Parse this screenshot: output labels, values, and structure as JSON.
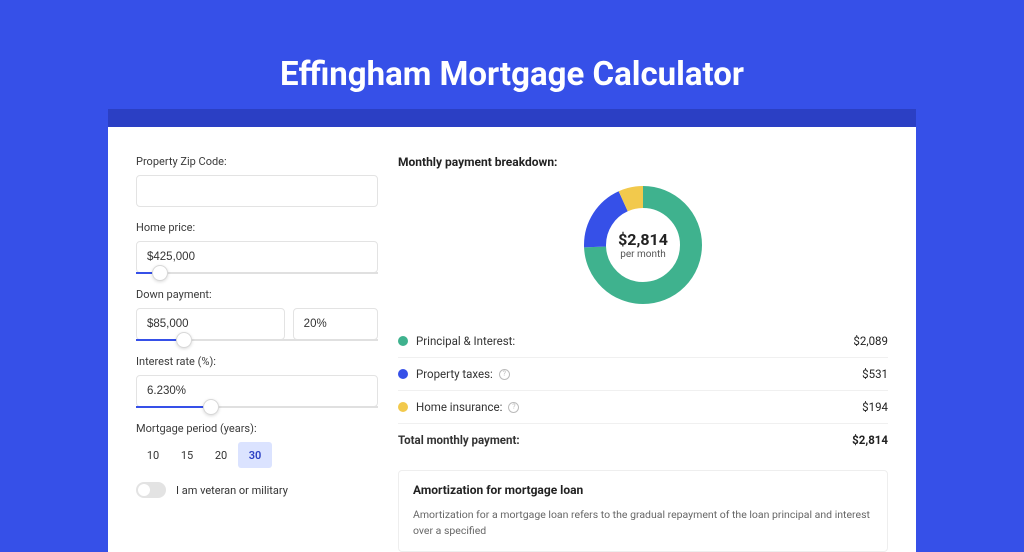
{
  "title": "Effingham Mortgage Calculator",
  "form": {
    "zip_label": "Property Zip Code:",
    "zip_value": "",
    "home_price_label": "Home price:",
    "home_price_value": "$425,000",
    "down_payment_label": "Down payment:",
    "down_payment_value": "$85,000",
    "down_payment_pct": "20%",
    "interest_label": "Interest rate (%):",
    "interest_value": "6.230%",
    "period_label": "Mortgage period (years):",
    "periods": [
      "10",
      "15",
      "20",
      "30"
    ],
    "period_selected": "30",
    "veteran_label": "I am veteran or military"
  },
  "breakdown": {
    "title": "Monthly payment breakdown:",
    "center_amount": "$2,814",
    "center_sub": "per month",
    "rows": [
      {
        "label": "Principal & Interest:",
        "value": "$2,089",
        "info": false
      },
      {
        "label": "Property taxes:",
        "value": "$531",
        "info": true
      },
      {
        "label": "Home insurance:",
        "value": "$194",
        "info": true
      }
    ],
    "total_label": "Total monthly payment:",
    "total_value": "$2,814"
  },
  "amort": {
    "title": "Amortization for mortgage loan",
    "text": "Amortization for a mortgage loan refers to the gradual repayment of the loan principal and interest over a specified"
  },
  "colors": {
    "pi": "#3fb28e",
    "tax": "#3650e8",
    "ins": "#f2c94c"
  },
  "chart_data": {
    "type": "pie",
    "title": "Monthly payment breakdown",
    "series": [
      {
        "name": "Principal & Interest",
        "value": 2089,
        "color": "#3fb28e"
      },
      {
        "name": "Property taxes",
        "value": 531,
        "color": "#3650e8"
      },
      {
        "name": "Home insurance",
        "value": 194,
        "color": "#f2c94c"
      }
    ],
    "total": 2814,
    "center_label": "$2,814 per month"
  }
}
